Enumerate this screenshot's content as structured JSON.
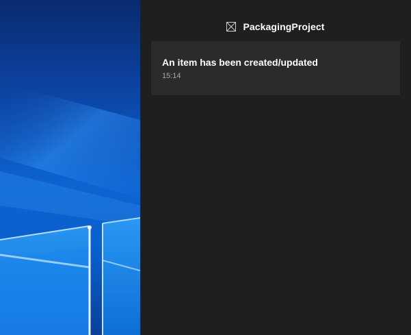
{
  "desktop": {
    "wallpaper_icon": "windows-logo-wallpaper",
    "colors": {
      "glow": "#bfe6ff",
      "pane": "#1e8df0"
    }
  },
  "action_center": {
    "background": "#1f1f1f",
    "group": {
      "app_name": "PackagingProject",
      "app_icon": "placeholder-app-icon"
    },
    "notifications": [
      {
        "title": "An item has been created/updated",
        "time": "15:14"
      }
    ]
  }
}
